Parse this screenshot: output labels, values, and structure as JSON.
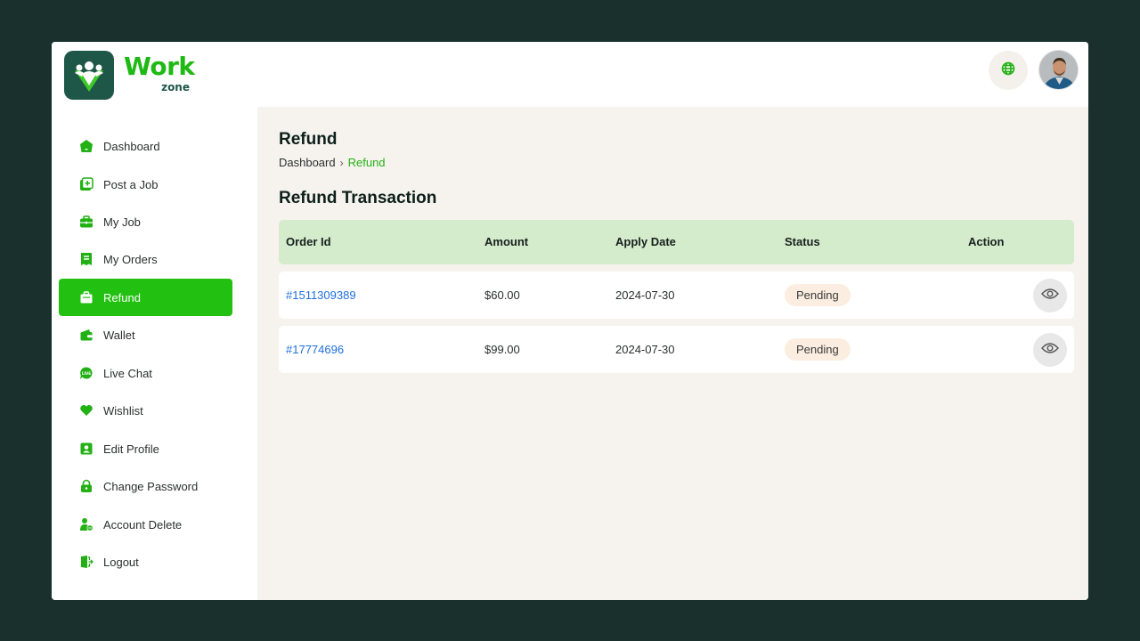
{
  "brand": {
    "name": "Work",
    "sub": "zone",
    "color": "#1fb914"
  },
  "header": {
    "globe_icon": "globe-icon",
    "avatar_alt": "user-avatar"
  },
  "sidebar": {
    "items": [
      {
        "label": "Dashboard",
        "icon": "home-icon",
        "active": false
      },
      {
        "label": "Post a Job",
        "icon": "post-job-icon",
        "active": false
      },
      {
        "label": "My Job",
        "icon": "briefcase-icon",
        "active": false
      },
      {
        "label": "My Orders",
        "icon": "orders-icon",
        "active": false
      },
      {
        "label": "Refund",
        "icon": "refund-icon",
        "active": true
      },
      {
        "label": "Wallet",
        "icon": "wallet-icon",
        "active": false
      },
      {
        "label": "Live Chat",
        "icon": "live-chat-icon",
        "active": false
      },
      {
        "label": "Wishlist",
        "icon": "heart-icon",
        "active": false
      },
      {
        "label": "Edit Profile",
        "icon": "profile-icon",
        "active": false
      },
      {
        "label": "Change Password",
        "icon": "lock-icon",
        "active": false
      },
      {
        "label": "Account Delete",
        "icon": "user-delete-icon",
        "active": false
      },
      {
        "label": "Logout",
        "icon": "logout-icon",
        "active": false
      }
    ]
  },
  "main": {
    "title": "Refund",
    "breadcrumb": {
      "home": "Dashboard",
      "separator": "›",
      "current": "Refund"
    },
    "section_title": "Refund Transaction",
    "table": {
      "headers": [
        "Order Id",
        "Amount",
        "Apply Date",
        "Status",
        "Action"
      ],
      "rows": [
        {
          "order_id": "#1511309389",
          "amount": "$60.00",
          "apply_date": "2024-07-30",
          "status": "Pending"
        },
        {
          "order_id": "#17774696",
          "amount": "$99.00",
          "apply_date": "2024-07-30",
          "status": "Pending"
        }
      ]
    }
  },
  "colors": {
    "accent": "#22c010",
    "dark_green": "#1e5648",
    "background": "#19302c",
    "header_row": "#d4ebcc",
    "pending_badge": "#fbeee0",
    "link": "#1f6fe0"
  }
}
